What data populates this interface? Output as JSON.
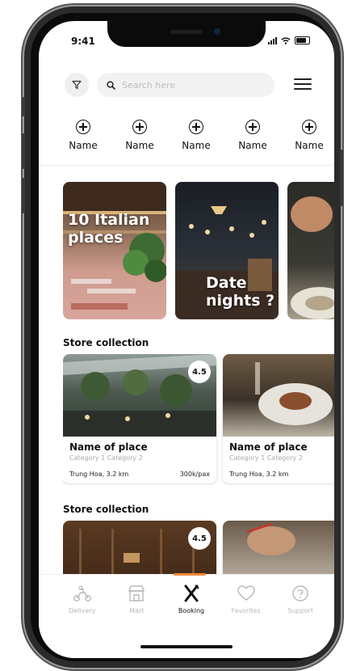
{
  "status_bar": {
    "time": "9:41"
  },
  "search": {
    "placeholder": "Search here"
  },
  "categories": [
    {
      "label": "Name",
      "icon": "add-circle-icon"
    },
    {
      "label": "Name",
      "icon": "add-circle-icon"
    },
    {
      "label": "Name",
      "icon": "add-circle-icon"
    },
    {
      "label": "Name",
      "icon": "add-circle-icon"
    },
    {
      "label": "Name",
      "icon": "add-circle-icon"
    }
  ],
  "promos": [
    {
      "title_line1": "10 Italian",
      "title_line2": "places"
    },
    {
      "title_line1": "Date",
      "title_line2": "nights ?"
    },
    {
      "title_line1": "",
      "title_line2": ""
    }
  ],
  "collections": [
    {
      "title": "Store collection",
      "stores": [
        {
          "rating": "4.5",
          "name": "Name of place",
          "categories": "Category 1   Category 2",
          "location": "Trung Hoa, 3.2 km",
          "price": "300k/pax"
        },
        {
          "rating": "",
          "name": "Name of place",
          "categories": "Category 1   Category 2",
          "location": "Trung Hoa, 3.2 km",
          "price": ""
        }
      ]
    },
    {
      "title": "Store collection",
      "stores": [
        {
          "rating": "4.5"
        },
        {
          "rating": ""
        }
      ]
    }
  ],
  "tabbar": {
    "items": [
      {
        "label": "Delivery",
        "icon": "scooter-icon"
      },
      {
        "label": "Mart",
        "icon": "store-icon"
      },
      {
        "label": "Booking",
        "icon": "utensils-icon",
        "active": true
      },
      {
        "label": "Favorites",
        "icon": "heart-icon"
      },
      {
        "label": "Support",
        "icon": "help-circle-icon"
      }
    ]
  },
  "colors": {
    "accent": "#f08a3c",
    "text": "#111111",
    "muted": "#b8b8b8"
  }
}
